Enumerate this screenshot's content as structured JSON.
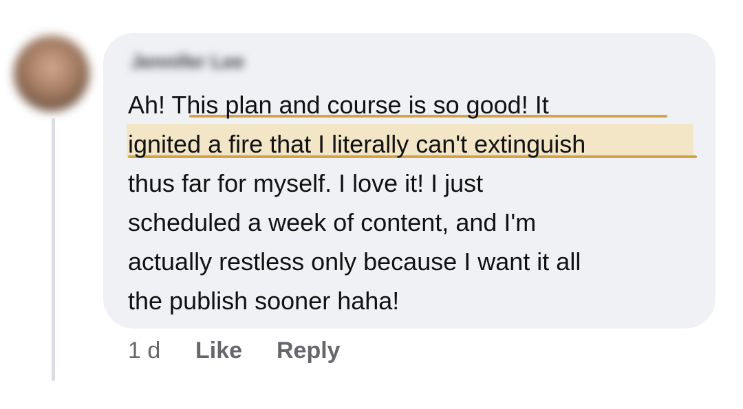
{
  "comment": {
    "author_name": "Jennifer Lee",
    "lines": [
      "Ah!  This plan and course is so good!  It",
      "ignited a fire that I literally can't extinguish",
      "thus far for myself.  I love it!  I just",
      "scheduled a week of content, and I'm",
      "actually restless only because I want it all",
      "the publish sooner haha!"
    ],
    "highlight_color": "#f3e6c6",
    "underline_color": "#d2a347",
    "bubble_color": "#f0f1f5"
  },
  "actions": {
    "timestamp": "1 d",
    "like_label": "Like",
    "reply_label": "Reply"
  }
}
